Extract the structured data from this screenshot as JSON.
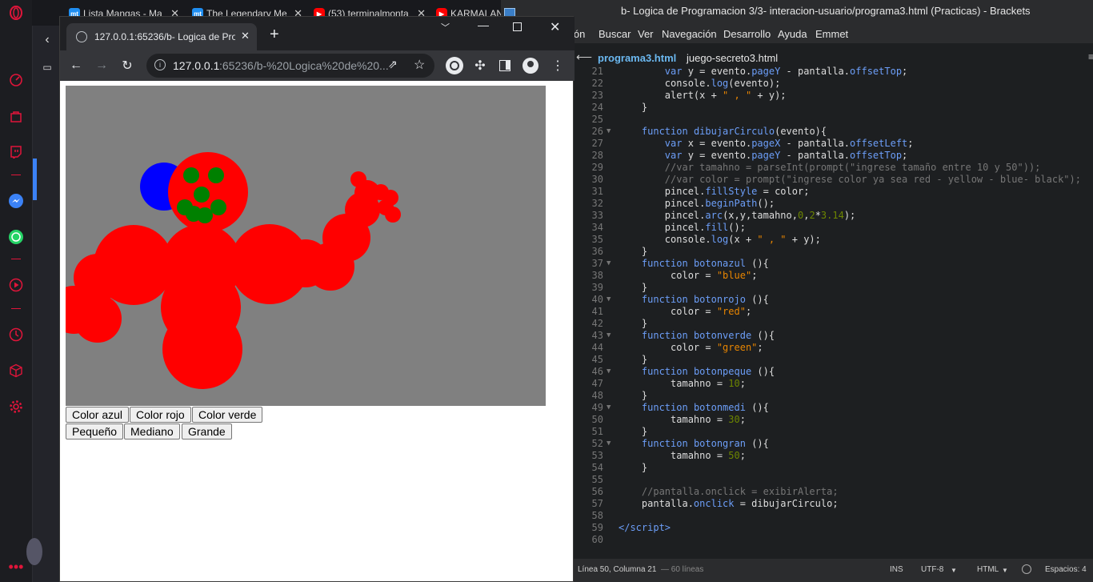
{
  "opera": {
    "tabs": [
      {
        "label": "Lista Mangas - Ma",
        "icon": "mt-icon",
        "color": "#1f8ef1"
      },
      {
        "label": "The Legendary Me",
        "icon": "mt-icon",
        "color": "#1f8ef1"
      },
      {
        "label": "(53) terminalmonta",
        "icon": "youtube-icon",
        "color": "#ff0000"
      },
      {
        "label": "KARMALAN",
        "icon": "youtube-icon",
        "color": "#ff0000"
      }
    ],
    "favicon_text": "mt",
    "accent": "#e0153a"
  },
  "chrome": {
    "tab_title": "127.0.0.1:65236/b- Logica de Pro",
    "url_host": "127.0.0.1",
    "url_path": ":65236/b-%20Logica%20de%20...",
    "new_tab": "+"
  },
  "page": {
    "buttons_row1": [
      "Color azul",
      "Color rojo",
      "Color verde"
    ],
    "buttons_row2": [
      "Pequeño",
      "Mediano",
      "Grande"
    ],
    "canvas_bg": "#808080"
  },
  "brackets": {
    "title": "b- Logica de Programacion 3/3- interacion-usuario/programa3.html (Practicas) - Brackets",
    "menu": [
      "ión",
      "Buscar",
      "Ver",
      "Navegación",
      "Desarrollo",
      "Ayuda",
      "Emmet"
    ],
    "tabs": [
      "programa3.html",
      "juego-secreto3.html"
    ],
    "status": {
      "position": "Línea 50, Columna 21",
      "lines": "— 60 líneas",
      "mode": "INS",
      "encoding": "UTF-8",
      "language": "HTML",
      "spaces": "Espacios: 4"
    }
  }
}
